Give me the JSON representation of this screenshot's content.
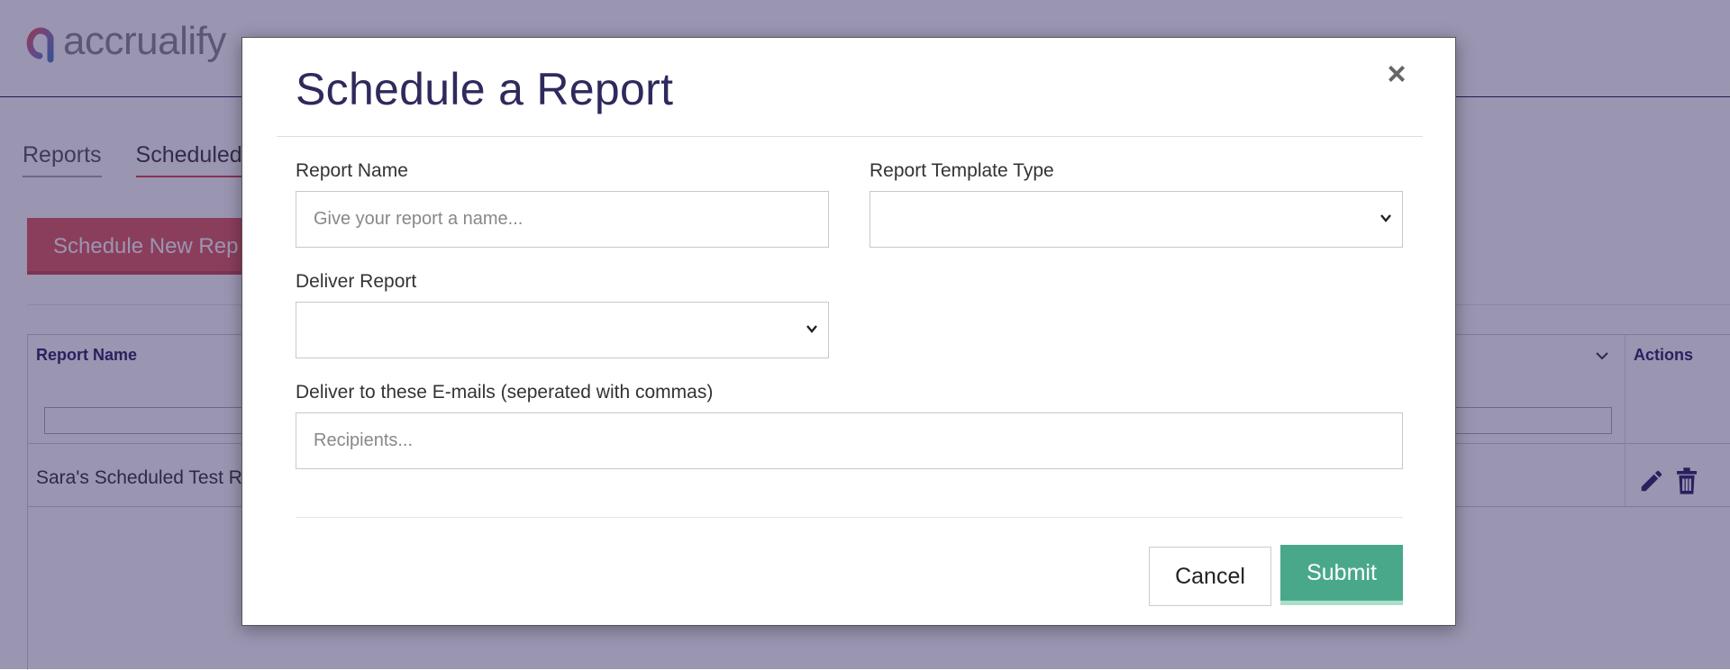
{
  "app": {
    "logo_text": "accrualify"
  },
  "tabs": [
    {
      "label": "Reports"
    },
    {
      "label": "Scheduled"
    }
  ],
  "background": {
    "schedule_button": "Schedule New Rep",
    "grid": {
      "columns": {
        "report_name": "Report Name",
        "actions": "Actions"
      },
      "rows": [
        {
          "report_name": "Sara's Scheduled Test Re"
        }
      ]
    }
  },
  "modal": {
    "title": "Schedule a Report",
    "close_label": "×",
    "fields": {
      "report_name": {
        "label": "Report Name",
        "placeholder": "Give your report a name..."
      },
      "template_type": {
        "label": "Report Template Type",
        "value": ""
      },
      "deliver_report": {
        "label": "Deliver Report",
        "value": ""
      },
      "emails": {
        "label": "Deliver to these E-mails (seperated with commas)",
        "placeholder": "Recipients..."
      }
    },
    "buttons": {
      "cancel": "Cancel",
      "submit": "Submit"
    }
  },
  "colors": {
    "accent_red": "#e25b5f",
    "submit_green": "#4aa88a",
    "title_navy": "#2e2a5c",
    "overlay": "rgba(40,30,90,0.47)"
  }
}
